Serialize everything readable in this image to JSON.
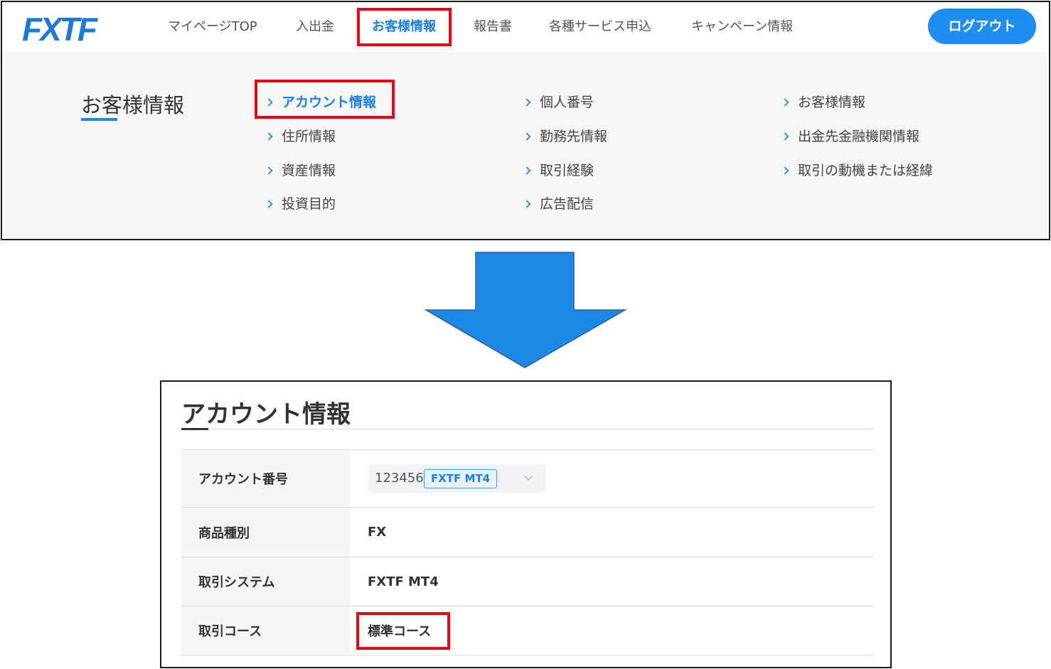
{
  "header": {
    "logo": "FXTF",
    "nav": [
      {
        "label": "マイページTOP"
      },
      {
        "label": "入出金"
      },
      {
        "label": "お客様情報",
        "active": true
      },
      {
        "label": "報告書"
      },
      {
        "label": "各種サービス申込"
      },
      {
        "label": "キャンペーン情報"
      }
    ],
    "logout_label": "ログアウト"
  },
  "submenu": {
    "title": "お客様情報",
    "links": [
      {
        "label": "アカウント情報",
        "active": true
      },
      {
        "label": "住所情報"
      },
      {
        "label": "資産情報"
      },
      {
        "label": "投資目的"
      },
      {
        "label": "個人番号"
      },
      {
        "label": "勤務先情報"
      },
      {
        "label": "取引経験"
      },
      {
        "label": "広告配信"
      },
      {
        "label": "お客様情報"
      },
      {
        "label": "出金先金融機関情報"
      },
      {
        "label": "取引の動機または経緯"
      }
    ]
  },
  "account_info": {
    "title": "アカウント情報",
    "rows": [
      {
        "label": "アカウント番号",
        "account_number": "123456",
        "platform_badge": "FXTF MT4"
      },
      {
        "label": "商品種別",
        "value": "FX"
      },
      {
        "label": "取引システム",
        "value": "FXTF MT4"
      },
      {
        "label": "取引コース",
        "value": "標準コース",
        "highlighted": true
      }
    ]
  },
  "colors": {
    "brand_blue": "#1e78d6",
    "active_text": "#1e7fe0",
    "logout_bg": "#1f8ef1",
    "highlight_red": "#e60012",
    "arrow_blue": "#1e88e5"
  },
  "icons": {
    "menu_chevron": "chevron-right-icon",
    "select_chevron": "chevron-down-icon",
    "transition_arrow": "down-arrow-icon"
  }
}
